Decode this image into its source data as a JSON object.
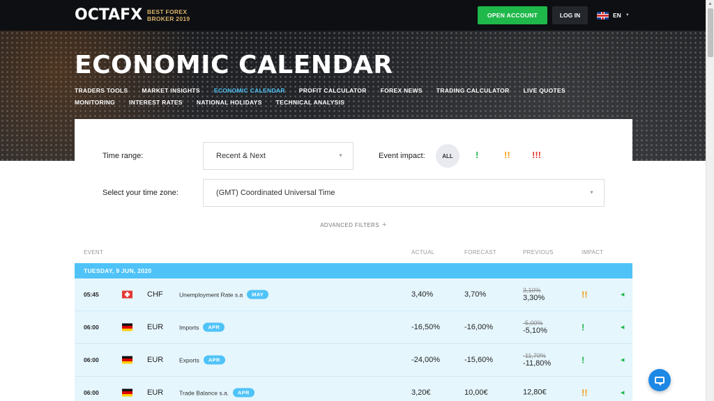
{
  "header": {
    "logo_text": "OCTAFX",
    "tagline_line1": "BEST FOREX",
    "tagline_line2": "BROKER 2019",
    "open_account_label": "OPEN ACCOUNT",
    "login_label": "LOG IN",
    "language_label": "EN",
    "flag_icon": "uk-flag-icon"
  },
  "hero": {
    "title": "ECONOMIC CALENDAR",
    "nav": [
      {
        "label": "TRADERS TOOLS",
        "active": false
      },
      {
        "label": "MARKET INSIGHTS",
        "active": false
      },
      {
        "label": "ECONOMIC CALENDAR",
        "active": true
      },
      {
        "label": "PROFIT CALCULATOR",
        "active": false
      },
      {
        "label": "FOREX NEWS",
        "active": false
      },
      {
        "label": "TRADING CALCULATOR",
        "active": false
      },
      {
        "label": "LIVE QUOTES",
        "active": false
      },
      {
        "label": "MONITORING",
        "active": false
      },
      {
        "label": "INTEREST RATES",
        "active": false
      },
      {
        "label": "NATIONAL HOLIDAYS",
        "active": false
      },
      {
        "label": "TECHNICAL ANALYSIS",
        "active": false
      }
    ]
  },
  "filters": {
    "time_range_label": "Time range:",
    "time_range_value": "Recent & Next",
    "event_impact_label": "Event impact:",
    "impact_all": "ALL",
    "impact_low": "!",
    "impact_medium": "!!",
    "impact_high": "!!!",
    "timezone_label": "Select your time zone:",
    "timezone_value": "(GMT) Coordinated Universal Time",
    "advanced_filters": "ADVANCED FILTERS",
    "advanced_plus": "+"
  },
  "table": {
    "headers": {
      "event": "EVENT",
      "actual": "ACTUAL",
      "forecast": "FORECAST",
      "previous": "PREVIOUS",
      "impact": "IMPACT"
    },
    "date": "TUESDAY, 9 JUN, 2020",
    "rows": [
      {
        "time": "05:45",
        "flag": "switzerland-flag-icon",
        "currency": "CHF",
        "event": "Unemployment Rate s.a",
        "period": "MAY",
        "actual": "3,40%",
        "forecast": "3,70%",
        "previous_old": "3,10%",
        "previous": "3,30%",
        "impact": "!!",
        "impact_level": "medium"
      },
      {
        "time": "06:00",
        "flag": "germany-flag-icon",
        "currency": "EUR",
        "event": "Imports",
        "period": "APR",
        "actual": "-16,50%",
        "forecast": "-16,00%",
        "previous_old": "-5,00%",
        "previous": "-5,10%",
        "impact": "!",
        "impact_level": "low"
      },
      {
        "time": "06:00",
        "flag": "germany-flag-icon",
        "currency": "EUR",
        "event": "Exports",
        "period": "APR",
        "actual": "-24,00%",
        "forecast": "-15,60%",
        "previous_old": "-11,70%",
        "previous": "-11,80%",
        "impact": "!",
        "impact_level": "low"
      },
      {
        "time": "06:00",
        "flag": "germany-flag-icon",
        "currency": "EUR",
        "event": "Trade Balance s.a.",
        "period": "APR",
        "actual": "3,20€",
        "forecast": "10,00€",
        "previous_old": "",
        "previous": "12,80€",
        "impact": "!!",
        "impact_level": "medium"
      }
    ]
  },
  "colors": {
    "accent": "#4fc3f7",
    "open_account": "#1fb84a",
    "impact_low": "#1fb84a",
    "impact_medium": "#f39c12",
    "impact_high": "#e53935"
  }
}
